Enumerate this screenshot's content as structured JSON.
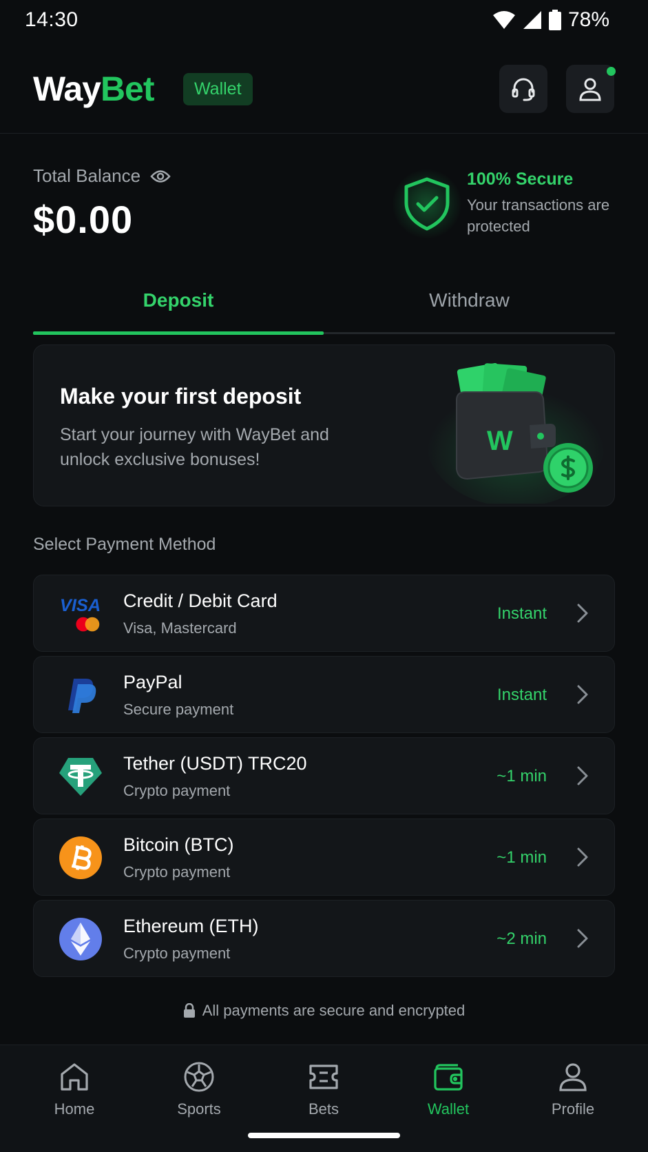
{
  "status": {
    "time": "14:30",
    "battery": "78%"
  },
  "header": {
    "logo_way": "Way",
    "logo_bet": "Bet",
    "badge": "Wallet"
  },
  "balance": {
    "label": "Total Balance",
    "value": "$0.00"
  },
  "security": {
    "title": "100% Secure",
    "desc": "Your transactions are protected"
  },
  "tabs": [
    {
      "label": "Deposit",
      "active": true
    },
    {
      "label": "Withdraw",
      "active": false
    }
  ],
  "promo": {
    "title": "Make your first deposit",
    "desc": "Start your journey with WayBet and unlock exclusive bonuses!",
    "wallet_letter": "W"
  },
  "payment_section_label": "Select Payment Method",
  "payment_methods": [
    {
      "name": "Credit / Debit Card",
      "sub": "Visa, Mastercard",
      "time": "Instant",
      "icon": "visa-mastercard-icon",
      "visa_text": "VISA"
    },
    {
      "name": "PayPal",
      "sub": "Secure payment",
      "time": "Instant",
      "icon": "paypal-icon"
    },
    {
      "name": "Tether (USDT) TRC20",
      "sub": "Crypto payment",
      "time": "~1 min",
      "icon": "tether-icon"
    },
    {
      "name": "Bitcoin (BTC)",
      "sub": "Crypto payment",
      "time": "~1 min",
      "icon": "bitcoin-icon"
    },
    {
      "name": "Ethereum (ETH)",
      "sub": "Crypto payment",
      "time": "~2 min",
      "icon": "ethereum-icon"
    }
  ],
  "secure_note": "All payments are secure and encrypted",
  "nav": [
    {
      "label": "Home",
      "active": false
    },
    {
      "label": "Sports",
      "active": false
    },
    {
      "label": "Bets",
      "active": false
    },
    {
      "label": "Wallet",
      "active": true
    },
    {
      "label": "Profile",
      "active": false
    }
  ],
  "colors": {
    "accent": "#22c55e",
    "background": "#0b0d0f",
    "card": "#131619"
  }
}
